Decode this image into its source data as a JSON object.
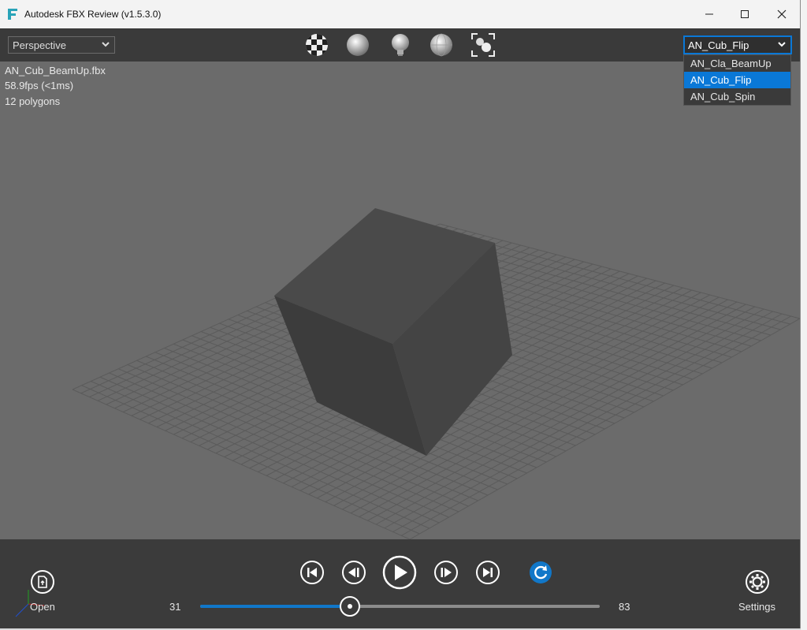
{
  "window": {
    "title": "Autodesk FBX Review (v1.5.3.0)"
  },
  "toolbar": {
    "view_mode": "Perspective",
    "icons": [
      "checker-texture-icon",
      "shaded-sphere-icon",
      "lightbulb-icon",
      "wireframe-sphere-icon",
      "frame-all-icon"
    ],
    "animation_selected": "AN_Cub_Flip",
    "animation_options": [
      "AN_Cla_BeamUp",
      "AN_Cub_Flip",
      "AN_Cub_Spin"
    ]
  },
  "viewport": {
    "file": "AN_Cub_BeamUp.fbx",
    "fps": "58.9fps (<1ms)",
    "polygons": "12 polygons"
  },
  "playback": {
    "open_label": "Open",
    "settings_label": "Settings",
    "start_frame": "31",
    "end_frame": "83",
    "progress": 0.375,
    "accent_color": "#1177c8"
  }
}
